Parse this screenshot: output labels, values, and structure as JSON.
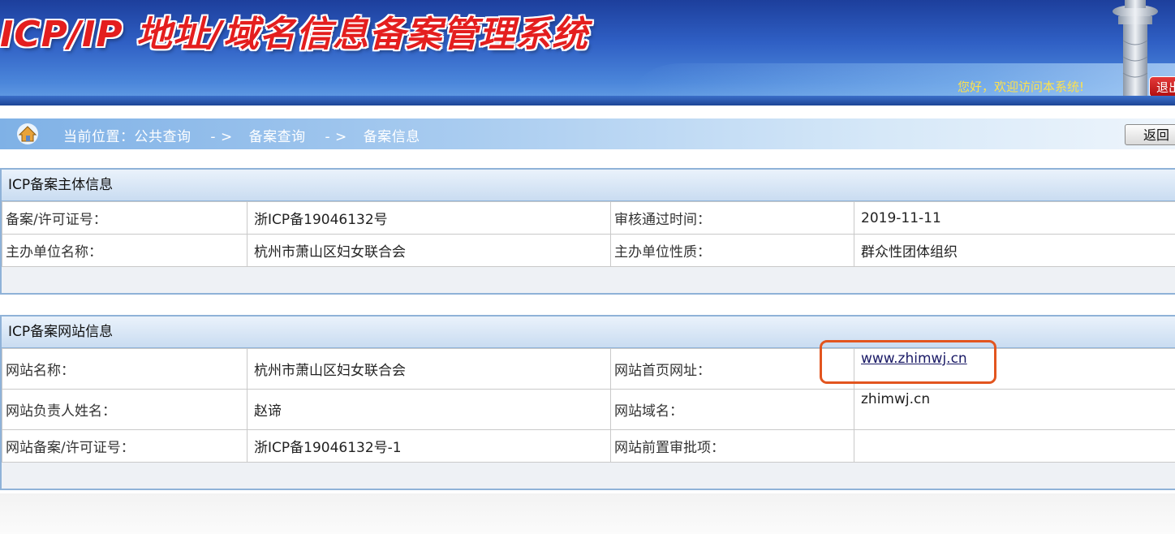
{
  "header": {
    "title": "ICP/IP 地址/域名信息备案管理系统",
    "welcome": "您好，欢迎访问本系统!",
    "logout_label": "退出"
  },
  "breadcrumb": {
    "items": [
      "当前位置：公共查询",
      "备案查询",
      "备案信息"
    ],
    "separator": "- >",
    "back_label": "返回"
  },
  "subject_panel": {
    "title": "ICP备案主体信息",
    "rows": [
      {
        "label1": "备案/许可证号：",
        "value1": "浙ICP备19046132号",
        "label2": "审核通过时间：",
        "value2": "2019-11-11"
      },
      {
        "label1": "主办单位名称：",
        "value1": "杭州市萧山区妇女联合会",
        "label2": "主办单位性质：",
        "value2": "群众性团体组织"
      }
    ]
  },
  "website_panel": {
    "title": "ICP备案网站信息",
    "rows": [
      {
        "label1": "网站名称：",
        "value1": "杭州市萧山区妇女联合会",
        "label2": "网站首页网址：",
        "value2": "www.zhimwj.cn"
      },
      {
        "label1": "网站负责人姓名：",
        "value1": "赵谛",
        "label2": "网站域名：",
        "value2": "zhimwj.cn"
      },
      {
        "label1": "网站备案/许可证号：",
        "value1": "浙ICP备19046132号-1",
        "label2": "网站前置审批项：",
        "value2": ""
      }
    ]
  },
  "colors": {
    "header_blue": "#2f5fc4",
    "title_red": "#e41e1e",
    "highlight_box": "#e2551f",
    "welcome_yellow": "#ffe24a"
  },
  "icons": [
    "home-icon",
    "pillar-ornament"
  ]
}
